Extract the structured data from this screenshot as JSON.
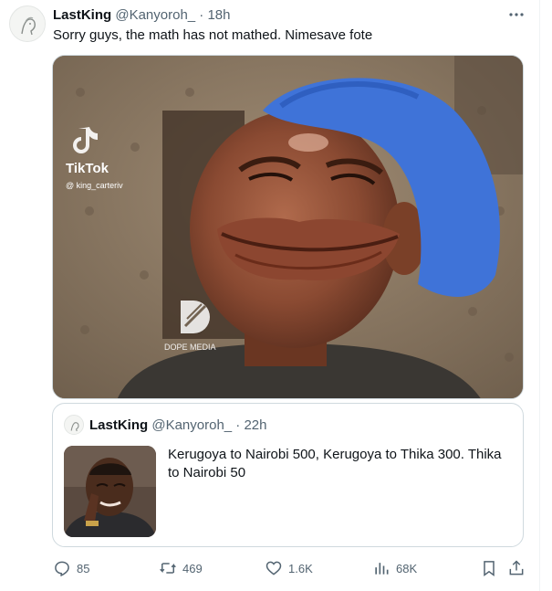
{
  "tweet": {
    "author_name": "LastKing",
    "author_handle": "@Kanyoroh_",
    "separator": "·",
    "time": "18h",
    "text": "Sorry guys, the math has not mathed. Nimesave fote",
    "media": {
      "watermark_app": "TikTok",
      "watermark_user": "@ king_carteriv",
      "overlay_brand": "DOPE MEDIA"
    }
  },
  "quoted_tweet": {
    "author_name": "LastKing",
    "author_handle": "@Kanyoroh_",
    "separator": "·",
    "time": "22h",
    "text": "Kerugoya to Nairobi 500, Kerugoya to Thika 300. Thika to Nairobi 50"
  },
  "actions": {
    "replies": "85",
    "retweets": "469",
    "likes": "1.6K",
    "views": "68K"
  },
  "colors": {
    "text_primary": "#0f1419",
    "text_secondary": "#536471",
    "border": "#cfd9de",
    "cap_blue": "#3f73d8"
  }
}
